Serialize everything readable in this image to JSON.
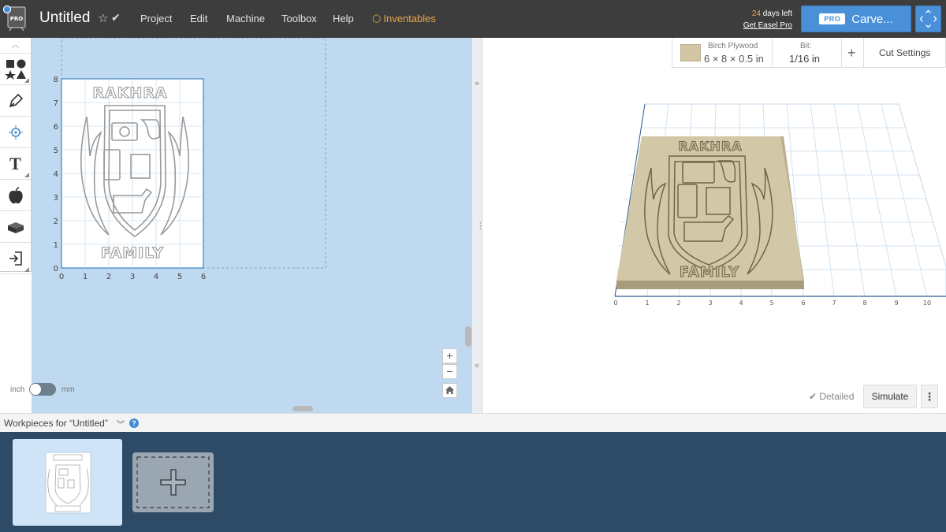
{
  "app": {
    "title": "Untitled",
    "menu": [
      "Project",
      "Edit",
      "Machine",
      "Toolbox",
      "Help"
    ],
    "inventables_label": "Inventables",
    "trial_days": "24",
    "trial_rest": "days left",
    "get_pro_label": "Get Easel Pro",
    "carve_pro_badge": "PRO",
    "carve_label": "Carve..."
  },
  "toolbox": {
    "tools": [
      "shapes-icon",
      "pen-icon",
      "point-icon",
      "text-icon",
      "apple-icon",
      "block-icon",
      "import-icon"
    ]
  },
  "canvas": {
    "units_inch": "inch",
    "units_mm": "mm",
    "x_ticks": [
      "0",
      "1",
      "2",
      "3",
      "4",
      "5",
      "6"
    ],
    "y_ticks": [
      "0",
      "1",
      "2",
      "3",
      "4",
      "5",
      "6",
      "7",
      "8"
    ],
    "design_title": "RAKHRA",
    "design_footer": "FAMILY"
  },
  "material": {
    "name": "Birch Plywood",
    "size": "6 × 8 × 0.5 in",
    "bit_label": "Bit:",
    "bit_value": "1/16 in",
    "cut_settings_label": "Cut Settings",
    "swatch_color": "#d2c6a4"
  },
  "preview": {
    "x_ticks": [
      "0",
      "1",
      "2",
      "3",
      "4",
      "5",
      "6",
      "7",
      "8",
      "9",
      "10"
    ],
    "detailed_label": "Detailed",
    "simulate_label": "Simulate"
  },
  "workpieces": {
    "title": "Workpieces for “Untitled”"
  },
  "colors": {
    "topbar": "#3d3d3d",
    "accent": "#4a90d9",
    "canvas_bg": "#bfd9f1",
    "workpiece_bar": "#2d4a66",
    "inventables": "#e8a64a"
  }
}
